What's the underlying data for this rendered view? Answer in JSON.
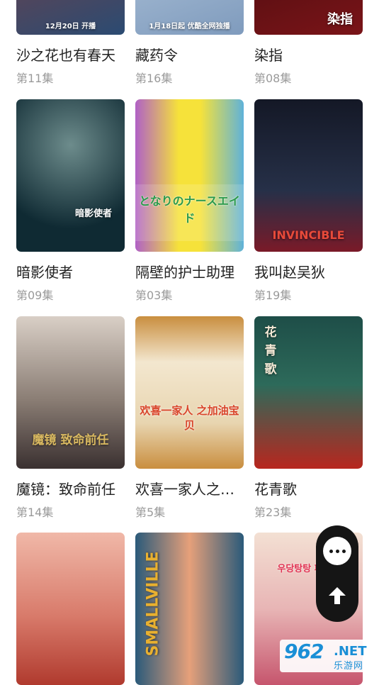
{
  "rows": [
    {
      "items": [
        {
          "title": "沙之花也有春天",
          "episode": "第11集",
          "poster_text": "12月20日 开播",
          "colors": [
            "#8a3d3a",
            "#2b4b72"
          ]
        },
        {
          "title": "藏药令",
          "episode": "第16集",
          "poster_text": "1月18日起 优酷全网独播",
          "colors": [
            "#bfd1e3",
            "#7f9bbd"
          ]
        },
        {
          "title": "染指",
          "episode": "第08集",
          "poster_text": "染指",
          "colors": [
            "#3a0a0c",
            "#7a1418"
          ]
        }
      ]
    },
    {
      "items": [
        {
          "title": "暗影使者",
          "episode": "第09集",
          "poster_text": "暗影使者",
          "colors": [
            "#0f2a33",
            "#4a6b70"
          ]
        },
        {
          "title": "隔壁的护士助理",
          "episode": "第03集",
          "poster_text": "となりのナースエイド",
          "colors": [
            "#f6e23a",
            "#5fb2d9"
          ]
        },
        {
          "title": "我叫赵吴狄",
          "episode": "第19集",
          "poster_text": "INVINCIBLE",
          "colors": [
            "#141826",
            "#7a1a28"
          ]
        }
      ]
    },
    {
      "items": [
        {
          "title": "魔镜：致命前任",
          "episode": "第14集",
          "poster_text": "魔镜 致命前任",
          "colors": [
            "#d9cfc6",
            "#3a3030"
          ]
        },
        {
          "title": "欢喜一家人之…",
          "episode": "第5集",
          "poster_text": "欢喜一家人 之加油宝贝",
          "colors": [
            "#f3e7cf",
            "#c98e3f"
          ]
        },
        {
          "title": "花青歌",
          "episode": "第23集",
          "poster_text": "花青歌",
          "colors": [
            "#1e4e48",
            "#b8261e"
          ]
        }
      ]
    },
    {
      "items": [
        {
          "title": "",
          "episode": "",
          "poster_text": "",
          "colors": [
            "#f0b8a8",
            "#b03a2e"
          ]
        },
        {
          "title": "",
          "episode": "",
          "poster_text": "SMALLVILLE",
          "colors": [
            "#e6a07a",
            "#2a5a7a"
          ]
        },
        {
          "title": "",
          "episode": "",
          "poster_text": "우당탕탕 패밀리",
          "colors": [
            "#f3e0d3",
            "#c6556d"
          ]
        }
      ]
    }
  ],
  "floating": {
    "chat_icon": "chat-bubble-icon",
    "top_icon": "arrow-up-icon"
  },
  "watermark": {
    "num": "962",
    "net": ".NET",
    "cn": "乐游网"
  }
}
